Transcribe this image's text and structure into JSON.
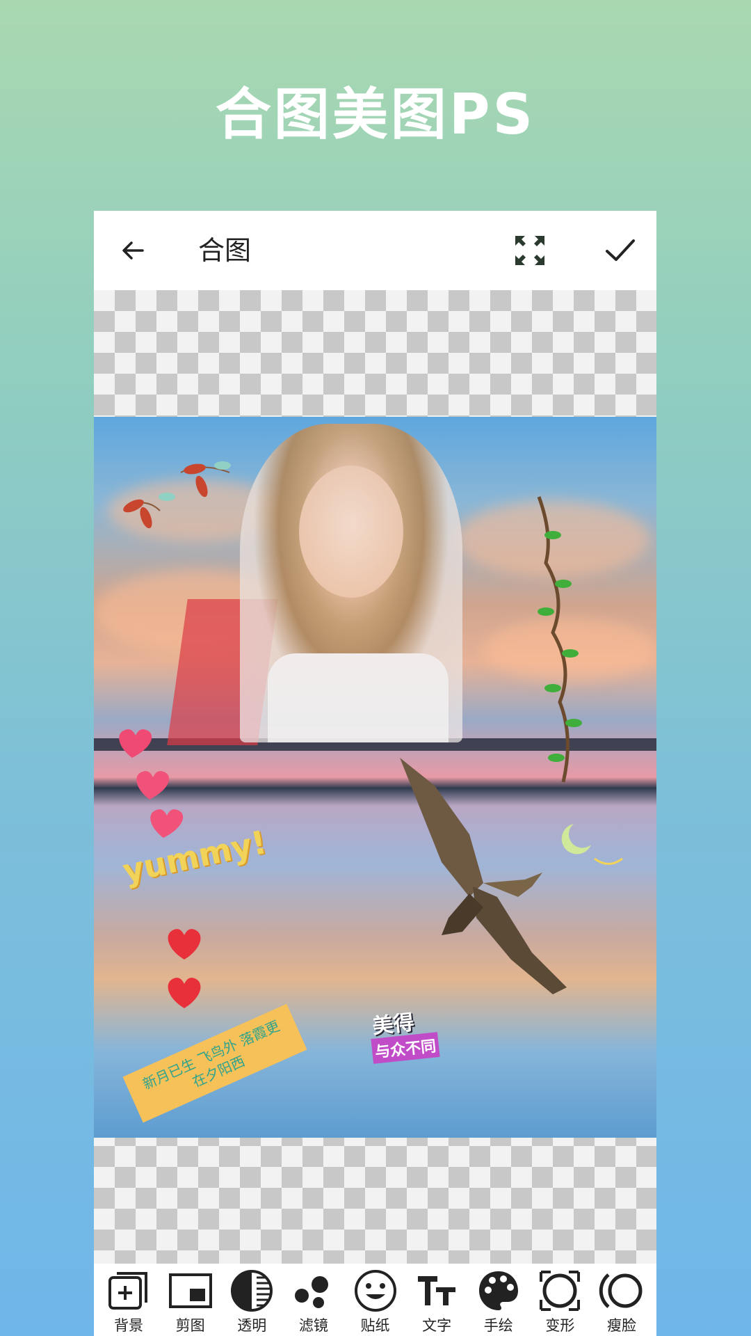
{
  "promo": {
    "title": "合图美图PS"
  },
  "appbar": {
    "title": "合图"
  },
  "stickers": {
    "yummy": "yummy!",
    "meide_line1": "美得",
    "meide_line2": "与众不同",
    "caption": "新月已生 飞鸟外 落霞更在夕阳西"
  },
  "toolbar": {
    "items": [
      {
        "label": "背景",
        "icon": "add-layer-icon"
      },
      {
        "label": "剪图",
        "icon": "crop-picture-icon"
      },
      {
        "label": "透明",
        "icon": "transparency-icon"
      },
      {
        "label": "滤镜",
        "icon": "filter-dots-icon"
      },
      {
        "label": "贴纸",
        "icon": "smiley-sticker-icon"
      },
      {
        "label": "文字",
        "icon": "text-tt-icon"
      },
      {
        "label": "手绘",
        "icon": "palette-icon"
      },
      {
        "label": "变形",
        "icon": "transform-icon"
      },
      {
        "label": "瘦脸",
        "icon": "slim-face-icon"
      }
    ]
  },
  "colors": {
    "accent": "#222222",
    "background_top": "#a9d8b0",
    "background_bottom": "#6fb6ea"
  }
}
